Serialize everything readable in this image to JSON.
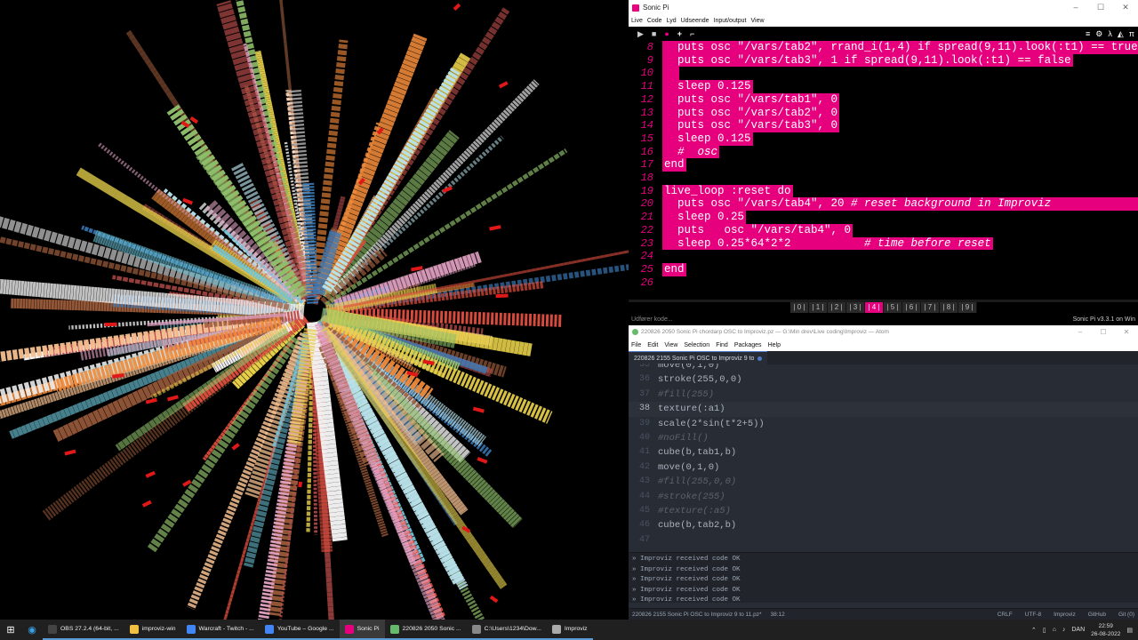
{
  "colors": {
    "sonic_pink": "#e6007e",
    "atom_bg": "#282c34",
    "taskbar_bg": "#202020"
  },
  "sonicpi": {
    "title": "Sonic Pi",
    "menu": [
      "Live",
      "Code",
      "Lyd",
      "Udseende",
      "Input/output",
      "View"
    ],
    "window_controls": [
      "–",
      "☐",
      "✕"
    ],
    "toolbar_icons": [
      "play-icon",
      "stop-icon",
      "record-icon",
      "new-buffer-icon",
      "save-icon"
    ],
    "toolbar_right": [
      "≡",
      "⚙",
      "λ",
      "◭",
      "π"
    ],
    "lines": [
      {
        "n": "8",
        "code": "  puts osc \"/vars/tab2\", rrand_i(1,4) if spread(9,11).look(:t1) == true a",
        "hl": true
      },
      {
        "n": "9",
        "code": "  puts osc \"/vars/tab3\", 1 if spread(9,11).look(:t1) == false",
        "hl": true
      },
      {
        "n": "10",
        "code": "  ",
        "hl": true
      },
      {
        "n": "11",
        "code": "  sleep 0.125",
        "hl": true
      },
      {
        "n": "12",
        "code": "  puts osc \"/vars/tab1\", 0",
        "hl": true
      },
      {
        "n": "13",
        "code": "  puts osc \"/vars/tab2\", 0",
        "hl": true
      },
      {
        "n": "14",
        "code": "  puts osc \"/vars/tab3\", 0",
        "hl": true
      },
      {
        "n": "15",
        "code": "  sleep 0.125",
        "hl": true
      },
      {
        "n": "16",
        "code": "  #  osc",
        "hl": true,
        "italic": true
      },
      {
        "n": "17",
        "code": "end",
        "hl": true
      },
      {
        "n": "18",
        "code": "",
        "hl": false
      },
      {
        "n": "19",
        "code": "live_loop :reset do",
        "hl": true
      },
      {
        "n": "20",
        "code": "  puts osc \"/vars/tab4\", 20 # reset background in Improviz                 ",
        "hl": true
      },
      {
        "n": "21",
        "code": "  sleep 0.25",
        "hl": true
      },
      {
        "n": "22",
        "code": "  puts   osc \"/vars/tab4\", 0",
        "hl": true
      },
      {
        "n": "23",
        "code": "  sleep 0.25*64*2*2           # time before reset",
        "hl": true
      },
      {
        "n": "24",
        "code": "",
        "hl": true
      },
      {
        "n": "25",
        "code": "end",
        "hl": true
      },
      {
        "n": "26",
        "code": "",
        "hl": false
      }
    ],
    "buffers": [
      "| 0 |",
      "| 1 |",
      "| 2 |",
      "| 3 |",
      "| 4 |",
      "| 5 |",
      "| 6 |",
      "| 7 |",
      "| 8 |",
      "| 9 |"
    ],
    "active_buffer": 4,
    "status_left": "Udfører kode...",
    "status_right": "Sonic Pi v3.3.1 on Win"
  },
  "atom": {
    "title": "220826 2050 Sonic Pi chordarp OSC to Improviz.pz — G:\\Min drev\\Live coding\\Improviz — Atom",
    "menu": [
      "File",
      "Edit",
      "View",
      "Selection",
      "Find",
      "Packages",
      "Help"
    ],
    "window_controls": [
      "–",
      "☐",
      "✕"
    ],
    "tab_label": "220826 2155 Sonic Pi OSC to Improviz  9 to",
    "lines": [
      {
        "n": "35",
        "code": "move(0,1,0)",
        "cmt": false
      },
      {
        "n": "36",
        "code": "stroke(255,0,0)",
        "cmt": false
      },
      {
        "n": "37",
        "code": "#fill(255)",
        "cmt": true
      },
      {
        "n": "38",
        "code": "texture(:a1)",
        "cmt": false,
        "cur": true
      },
      {
        "n": "39",
        "code": "scale(2*sin(t*2+5))",
        "cmt": false
      },
      {
        "n": "40",
        "code": "#noFill()",
        "cmt": true
      },
      {
        "n": "41",
        "code": "cube(b,tab1,b)",
        "cmt": false
      },
      {
        "n": "42",
        "code": "move(0,1,0)",
        "cmt": false
      },
      {
        "n": "43",
        "code": "#fill(255,0,0)",
        "cmt": true
      },
      {
        "n": "44",
        "code": "#stroke(255)",
        "cmt": true
      },
      {
        "n": "45",
        "code": "#texture(:a5)",
        "cmt": true
      },
      {
        "n": "46",
        "code": "cube(b,tab2,b)",
        "cmt": false
      },
      {
        "n": "47",
        "code": "",
        "cmt": false
      }
    ],
    "console": [
      "» Improviz received code OK",
      "» Improviz received code OK",
      "» Improviz received code OK",
      "» Improviz received code OK",
      "» Improviz received code OK"
    ],
    "status_file": "220826 2155 Sonic Pi OSC to Improviz 9 to 11.pz*",
    "status_cursor": "38:12",
    "status_right": [
      "CRLF",
      "UTF-8",
      "Improviz",
      "GitHub",
      "Git (0)"
    ]
  },
  "taskbar": {
    "items": [
      {
        "label": "OBS 27.2.4 (64-bit, ...",
        "color": "#444",
        "icon": "obs-icon"
      },
      {
        "label": "improviz-win",
        "color": "#f0c040",
        "icon": "folder-icon"
      },
      {
        "label": "Warcraft - Twitch - ...",
        "color": "#4285f4",
        "icon": "chrome-icon"
      },
      {
        "label": "YouTube – Google ...",
        "color": "#4285f4",
        "icon": "chrome-icon"
      },
      {
        "label": "Sonic Pi",
        "color": "#e6007e",
        "icon": "sonic-pi-icon",
        "active": true
      },
      {
        "label": "220826 2050 Sonic ...",
        "color": "#66bb6a",
        "icon": "atom-icon"
      },
      {
        "label": "C:\\Users\\1234\\Dow...",
        "color": "#888",
        "icon": "terminal-icon"
      },
      {
        "label": "Improviz",
        "color": "#aaa",
        "icon": "improviz-icon"
      }
    ],
    "tray_lang": "DAN",
    "time": "22:59",
    "date": "26-08-2022"
  }
}
